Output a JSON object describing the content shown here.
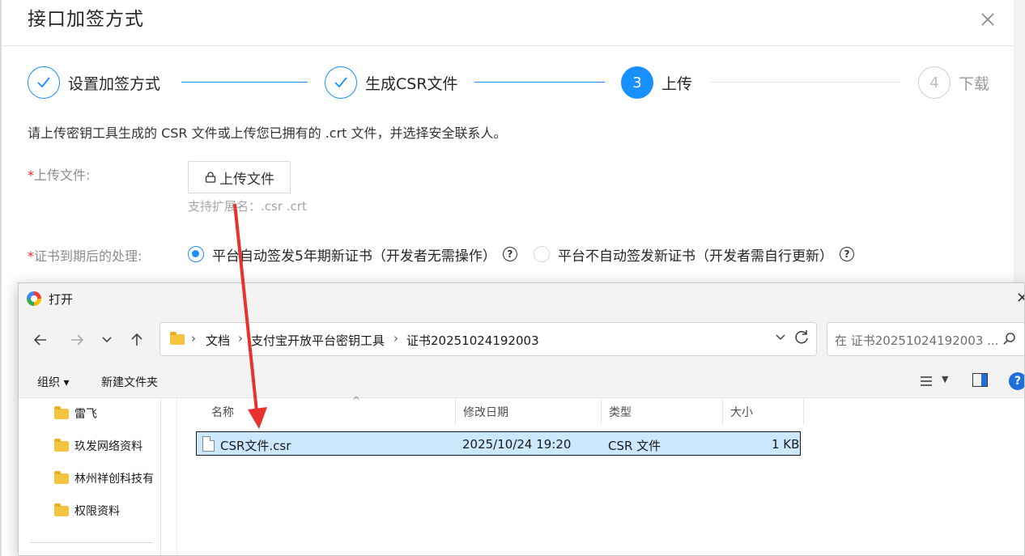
{
  "dialog": {
    "title": "接口加签方式",
    "steps": [
      {
        "number": "1",
        "label": "设置加签方式",
        "status": "done"
      },
      {
        "number": "2",
        "label": "生成CSR文件",
        "status": "done"
      },
      {
        "number": "3",
        "label": "上传",
        "status": "active"
      },
      {
        "number": "4",
        "label": "下载",
        "status": "wait"
      }
    ],
    "description": "请上传密钥工具生成的 CSR 文件或上传您已拥有的 .crt 文件，并选择安全联系人。",
    "upload_label_req": "*",
    "upload_label": "上传文件:",
    "upload_button": "上传文件",
    "upload_hint": "支持扩展名：.csr .crt",
    "expiry_label_req": "*",
    "expiry_label": "证书到期后的处理:",
    "expiry_options": [
      {
        "label": "平台自动签发5年期新证书（开发者无需操作）",
        "selected": true
      },
      {
        "label": "平台不自动签发新证书（开发者需自行更新）",
        "selected": false
      }
    ]
  },
  "file_dialog": {
    "title": "打开",
    "breadcrumb": [
      "文档",
      "支付宝开放平台密钥工具",
      "证书20251024192003"
    ],
    "search_placeholder": "在 证书20251024192003 ...",
    "toolbar": {
      "organize": "组织 ▾",
      "new_folder": "新建文件夹"
    },
    "sidebar": [
      "雷飞",
      "玖发网络资料",
      "林州祥创科技有",
      "权限资料"
    ],
    "columns": [
      "名称",
      "修改日期",
      "类型",
      "大小"
    ],
    "files": [
      {
        "name": "CSR文件.csr",
        "modified": "2025/10/24 19:20",
        "type": "CSR 文件",
        "size": "1 KB",
        "selected": true
      }
    ]
  },
  "colors": {
    "accent": "#1890ff",
    "selection": "#cce8ff",
    "annotation_arrow": "#e8322e"
  },
  "icons": [
    "check-icon",
    "close-icon",
    "lock-icon",
    "help-icon",
    "folder-icon",
    "file-icon",
    "search-icon",
    "refresh-icon",
    "back-arrow-icon",
    "forward-arrow-icon",
    "up-arrow-icon"
  ]
}
